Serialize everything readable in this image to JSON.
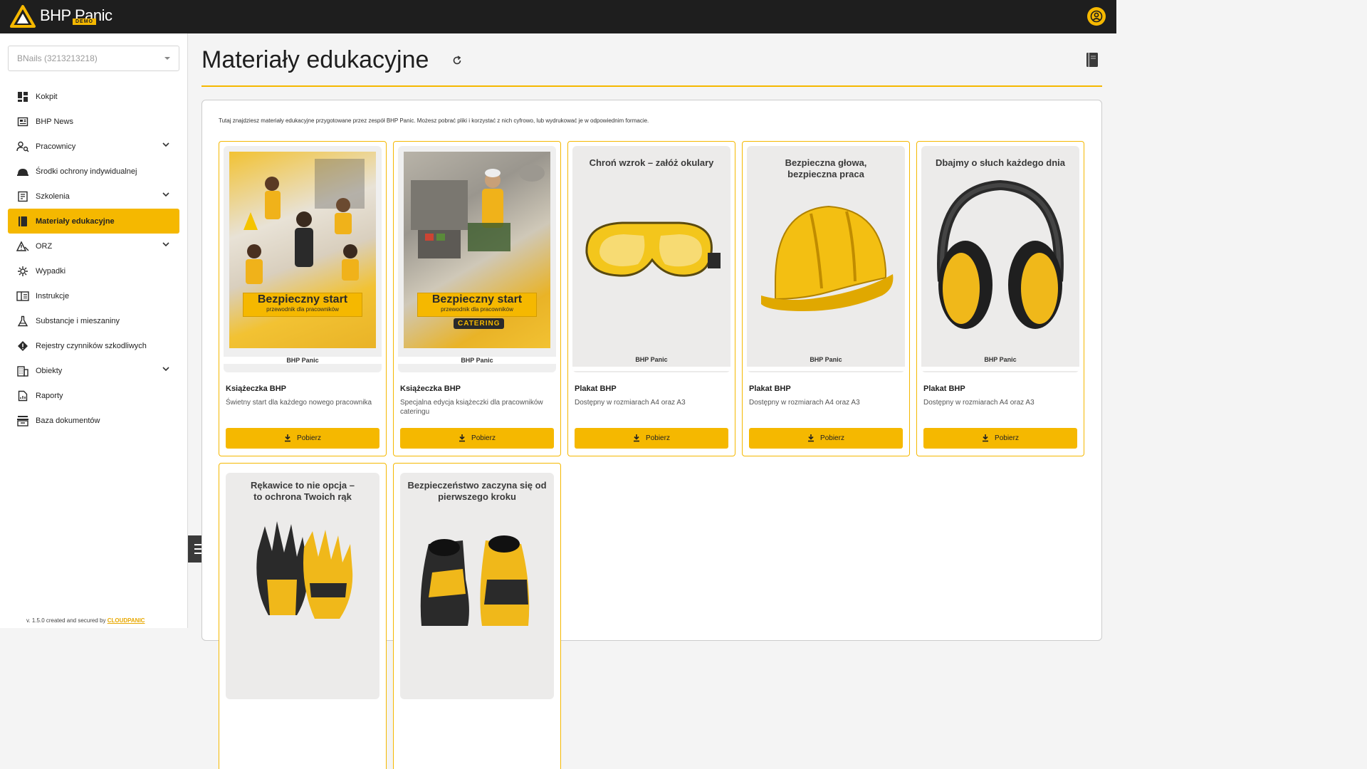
{
  "app": {
    "name": "BHP Panic",
    "badge": "DEMO"
  },
  "sidebar": {
    "company_select": "BNails (3213213218)",
    "items": [
      {
        "label": "Kokpit",
        "icon": "dashboard-icon",
        "expandable": false
      },
      {
        "label": "BHP News",
        "icon": "news-icon",
        "expandable": false
      },
      {
        "label": "Pracownicy",
        "icon": "user-search-icon",
        "expandable": true
      },
      {
        "label": "Środki ochrony indywidualnej",
        "icon": "helmet-icon",
        "expandable": false
      },
      {
        "label": "Szkolenia",
        "icon": "training-icon",
        "expandable": true
      },
      {
        "label": "Materiały edukacyjne",
        "icon": "book-icon",
        "expandable": false,
        "active": true
      },
      {
        "label": "ORZ",
        "icon": "risk-icon",
        "expandable": true
      },
      {
        "label": "Wypadki",
        "icon": "accident-icon",
        "expandable": false
      },
      {
        "label": "Instrukcje",
        "icon": "instructions-icon",
        "expandable": false
      },
      {
        "label": "Substancje i mieszaniny",
        "icon": "flask-icon",
        "expandable": false
      },
      {
        "label": "Rejestry czynników szkodliwych",
        "icon": "warning-diamond-icon",
        "expandable": false
      },
      {
        "label": "Obiekty",
        "icon": "building-icon",
        "expandable": true
      },
      {
        "label": "Raporty",
        "icon": "report-icon",
        "expandable": false
      },
      {
        "label": "Baza dokumentów",
        "icon": "archive-icon",
        "expandable": false
      }
    ],
    "version_prefix": "v. 1.5.0 created and secured by",
    "version_link": "CLOUDPANIC"
  },
  "main": {
    "title": "Materiały edukacyjne",
    "intro": "Tutaj znajdziesz materiały edukacyjne przygotowane przez zespół BHP Panic. Możesz pobrać pliki i korzystać z nich cyfrowo, lub wydrukować je w odpowiednim formacie.",
    "download_label": "Pobierz",
    "cards": [
      {
        "title": "Książeczka BHP",
        "desc": "Świetny start dla każdego nowego pracownika",
        "poster_heading": "Bezpieczny start",
        "poster_sub": "przewodnik dla pracowników",
        "poster_tag": ""
      },
      {
        "title": "Książeczka BHP",
        "desc": "Specjalna edycja książeczki dla pracowników cateringu",
        "poster_heading": "Bezpieczny start",
        "poster_sub": "przewodnik dla pracowników",
        "poster_tag": "CATERING"
      },
      {
        "title": "Plakat BHP",
        "desc": "Dostępny w rozmiarach A4 oraz A3",
        "poster_heading": "Chroń wzrok – załóż okulary"
      },
      {
        "title": "Plakat BHP",
        "desc": "Dostępny w rozmiarach A4 oraz A3",
        "poster_heading": "Bezpieczna głowa, bezpieczna praca"
      },
      {
        "title": "Plakat BHP",
        "desc": "Dostępny w rozmiarach A4 oraz A3",
        "poster_heading": "Dbajmy o słuch każdego dnia"
      },
      {
        "poster_heading": "Rękawice to nie opcja – to ochrona Twoich rąk"
      },
      {
        "poster_heading": "Bezpieczeństwo zaczyna się od pierwszego kroku"
      }
    ],
    "poster_brand": "BHP Panic"
  },
  "colors": {
    "accent": "#f5b800",
    "topbar": "#1e1e1e"
  }
}
